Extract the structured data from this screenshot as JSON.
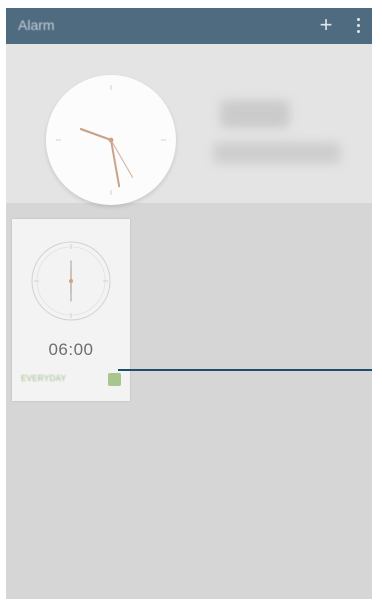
{
  "action_bar": {
    "title": "Alarm",
    "add_icon": "plus-icon",
    "more_icon": "overflow-menu-icon",
    "background": "#4f6b80"
  },
  "world_clock": {
    "hour_hand_deg": 290,
    "minute_hand_deg": 170,
    "second_hand_deg": 150
  },
  "alarms": [
    {
      "time": "06:00",
      "repeat": "EVERYDAY",
      "enabled": true,
      "accent": "#a8c58f"
    }
  ],
  "callout": {
    "color": "#1f4e6b"
  }
}
